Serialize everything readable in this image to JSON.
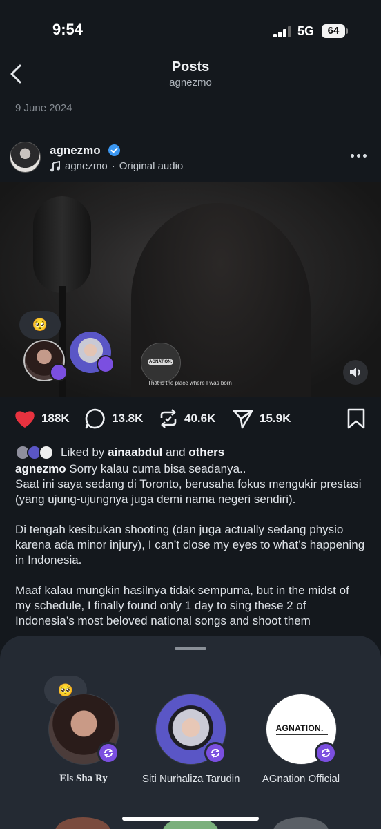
{
  "status_bar": {
    "time": "9:54",
    "network": "5G",
    "battery": "64"
  },
  "header": {
    "title": "Posts",
    "subtitle": "agnezmo"
  },
  "post": {
    "date": "9 June 2024",
    "author": "agnezmo",
    "audio_author": "agnezmo",
    "audio_separator": "·",
    "audio_label": "Original audio",
    "media": {
      "reaction_emoji": "🥺",
      "overlay_caption": "That is the place where I was born",
      "overlay_logo": "AGNATION."
    },
    "actions": {
      "likes": "188K",
      "comments": "13.8K",
      "reposts": "40.6K",
      "shares": "15.9K"
    },
    "liked_by": {
      "prefix": "Liked by",
      "user": "ainaabdul",
      "connector": "and",
      "others": "others"
    },
    "caption": {
      "username": "agnezmo",
      "line1": "Sorry kalau cuma bisa seadanya..",
      "paragraph1": "Saat ini saya sedang di Toronto, berusaha fokus mengukir prestasi (yang ujung-ujungnya juga demi nama negeri sendiri).",
      "paragraph2": "Di tengah kesibukan shooting (dan juga actually sedang physio karena ada minor injury), I can’t close my eyes to what’s happening in Indonesia.",
      "paragraph3": "Maaf kalau mungkin hasilnya tidak sempurna, but in the midst of my schedule, I finally found only 1 day to sing these 2 of Indonesia’s most beloved national songs and shoot them"
    }
  },
  "sheet": {
    "reaction_emoji": "🥺",
    "creators": [
      {
        "name": "Els Sha Ry"
      },
      {
        "name": "Siti Nurhaliza Tarudin"
      },
      {
        "name": "AGnation Official",
        "logo": "AGNATION."
      }
    ]
  },
  "colors": {
    "like": "#e8323f",
    "remix": "#7b4fe0",
    "verified": "#3b97f2",
    "sheet_bg": "#242a33"
  }
}
